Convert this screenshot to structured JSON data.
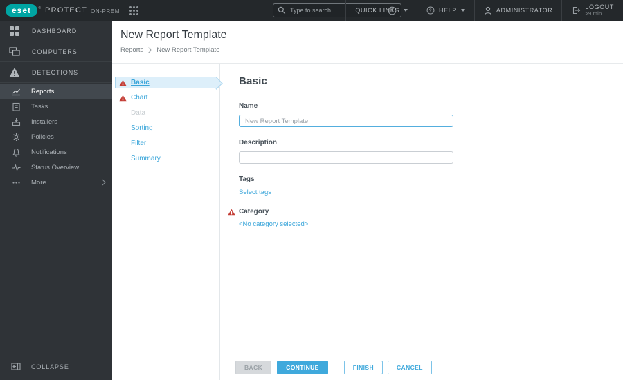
{
  "topbar": {
    "logo_text": "eset",
    "logo_reg": "®",
    "product_name": "PROTECT",
    "product_edition": "ON-PREM",
    "search_placeholder": "Type to search ...",
    "quick_links_label": "QUICK LINKS",
    "help_label": "HELP",
    "user_label": "ADMINISTRATOR",
    "logout_label": "LOGOUT",
    "logout_timeout": ">9 min"
  },
  "sidebar": {
    "primary_items": [
      {
        "label": "DASHBOARD",
        "icon": "dashboard-icon"
      },
      {
        "label": "COMPUTERS",
        "icon": "computers-icon"
      },
      {
        "label": "DETECTIONS",
        "icon": "detections-icon"
      }
    ],
    "secondary_items": [
      {
        "label": "Reports",
        "icon": "reports-icon",
        "active": true
      },
      {
        "label": "Tasks",
        "icon": "tasks-icon"
      },
      {
        "label": "Installers",
        "icon": "installers-icon"
      },
      {
        "label": "Policies",
        "icon": "policies-icon"
      },
      {
        "label": "Notifications",
        "icon": "notifications-icon"
      },
      {
        "label": "Status Overview",
        "icon": "status-overview-icon"
      },
      {
        "label": "More",
        "icon": "more-icon",
        "chevron": true
      }
    ],
    "collapse_label": "COLLAPSE"
  },
  "page": {
    "title": "New Report Template",
    "breadcrumb": {
      "parent": "Reports",
      "current": "New Report Template"
    }
  },
  "wizard_steps": [
    {
      "label": "Basic",
      "state": "active",
      "warning": true
    },
    {
      "label": "Chart",
      "state": "default",
      "warning": true
    },
    {
      "label": "Data",
      "state": "disabled",
      "warning": false
    },
    {
      "label": "Sorting",
      "state": "default",
      "warning": false
    },
    {
      "label": "Filter",
      "state": "default",
      "warning": false
    },
    {
      "label": "Summary",
      "state": "default",
      "warning": false
    }
  ],
  "form": {
    "section_heading": "Basic",
    "name_label": "Name",
    "name_value": "New Report Template",
    "description_label": "Description",
    "description_value": "",
    "tags_label": "Tags",
    "tags_link": "Select tags",
    "category_label": "Category",
    "category_value": "<No category selected>"
  },
  "footer_buttons": {
    "back": "BACK",
    "continue": "CONTINUE",
    "finish": "FINISH",
    "cancel": "CANCEL"
  },
  "colors": {
    "accent_blue": "#3ba6da",
    "warning_red": "#c43e36",
    "brand_teal": "#00a5a3",
    "topbar_bg": "#24282b",
    "sidebar_bg": "#2f3337",
    "selected_step_bg": "#ddeffa"
  }
}
